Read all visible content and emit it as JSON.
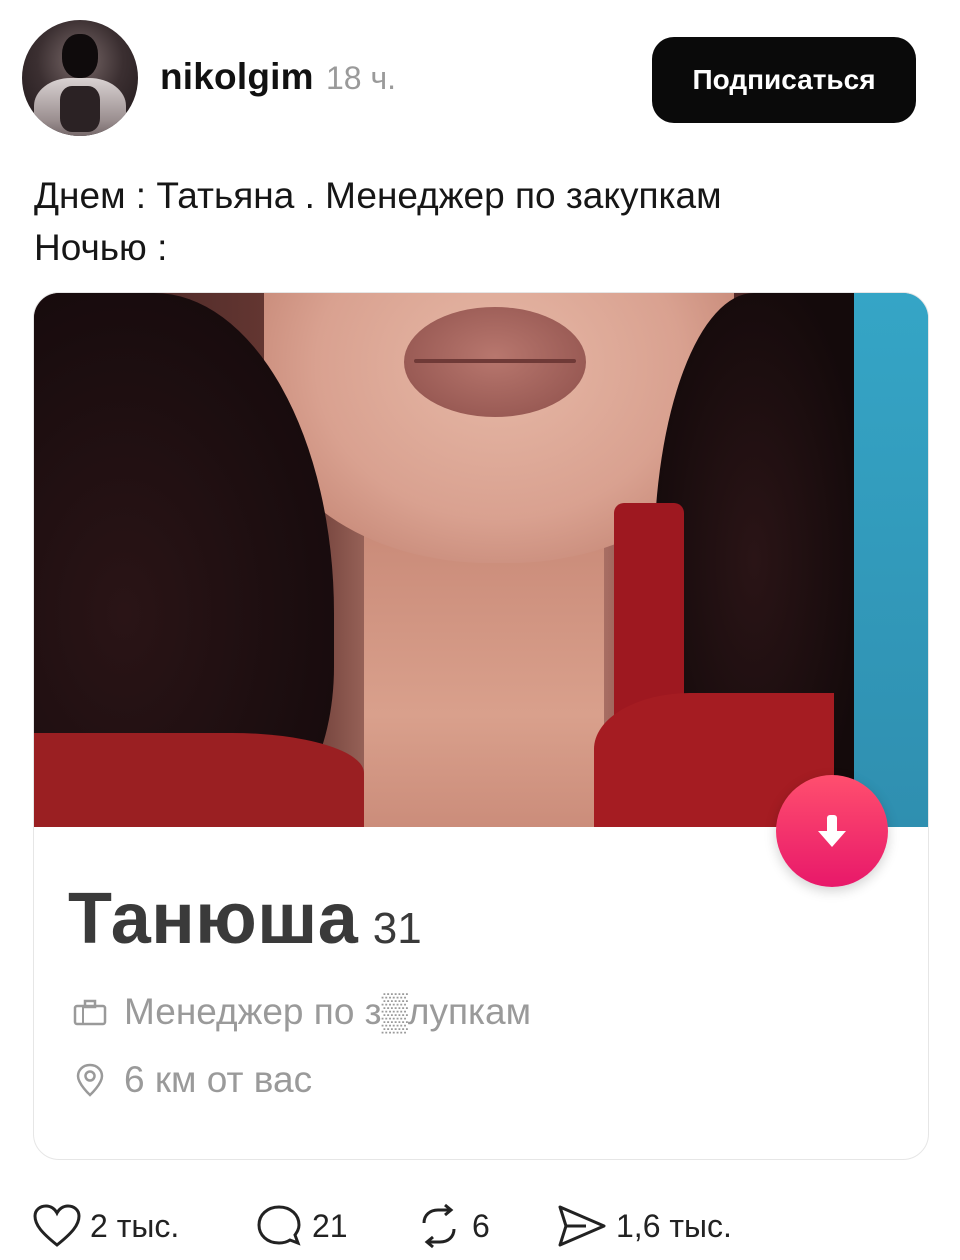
{
  "header": {
    "username": "nikolgim",
    "time": "18 ч.",
    "follow_label": "Подписаться"
  },
  "caption": {
    "line1": "Днем : Татьяна . Менеджер по закупкам",
    "line2": "Ночью :"
  },
  "card": {
    "name": "Танюша",
    "age": "31",
    "job": "Менеджер по з▒лупкам",
    "distance": "6 км от вас"
  },
  "actions": {
    "likes": "2 тыс.",
    "comments": "21",
    "reposts": "6",
    "shares": "1,6 тыс."
  },
  "colors": {
    "button_bg": "#0a0a0a",
    "accent_pink": "#e8186a",
    "muted_text": "#9a9a9a"
  }
}
